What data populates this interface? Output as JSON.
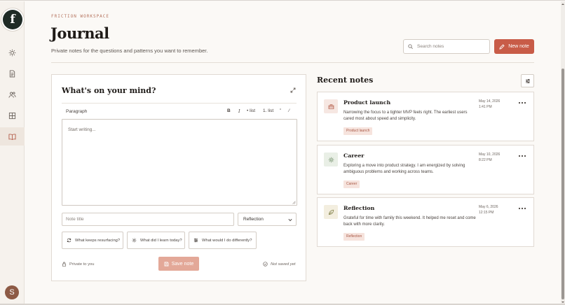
{
  "sidebar": {
    "logo_letter": "f",
    "nav": [
      {
        "name": "dashboard",
        "icon": "sun-icon"
      },
      {
        "name": "documents",
        "icon": "document-icon"
      },
      {
        "name": "people",
        "icon": "people-icon"
      },
      {
        "name": "grid",
        "icon": "grid-icon"
      },
      {
        "name": "journal",
        "icon": "book-icon",
        "active": true
      }
    ],
    "avatar_letter": "S"
  },
  "header": {
    "eyebrow": "FRICTION WORKSPACE",
    "title": "Journal",
    "subtitle": "Private notes for the questions and patterns you want to remember.",
    "search_placeholder": "Search notes",
    "new_note_label": "New note"
  },
  "composer": {
    "title": "What's on your mind?",
    "format_label": "Paragraph",
    "toolbar": {
      "bold": "B",
      "italic": "I",
      "bullet": "• list",
      "numbered": "1. list",
      "quote": "”",
      "link": "⁄"
    },
    "editor_placeholder": "Start writing...",
    "note_title_placeholder": "Note title",
    "category_value": "Reflection",
    "prompts": [
      {
        "label": "What keeps resurfacing?",
        "icon": "refresh-icon"
      },
      {
        "label": "What did I learn today?",
        "icon": "sun-icon"
      },
      {
        "label": "What would I do differently?",
        "icon": "sliders-icon"
      }
    ],
    "privacy_label": "Private to you",
    "save_label": "Save note",
    "save_status": "Not saved yet"
  },
  "recent": {
    "title": "Recent notes",
    "notes": [
      {
        "title": "Product launch",
        "body": "Narrowing the focus to a tighter MVP feels right. The earliest users cared most about speed and simplicity.",
        "tag": "Product launch",
        "date": "May 14, 2026",
        "time": "1:41 PM",
        "icon": "briefcase-icon",
        "icon_bg": "#f6e7e2",
        "icon_color": "#b5604d",
        "tag_bg": "#f6e3dd",
        "tag_color": "#a85744"
      },
      {
        "title": "Career",
        "body": "Exploring a move into product strategy. I am energized by solving ambiguous problems and working across teams.",
        "tag": "Career",
        "date": "May 10, 2026",
        "time": "8:22 PM",
        "icon": "sun-icon",
        "icon_bg": "#e9efe6",
        "icon_color": "#6c8a64",
        "tag_bg": "#f6e3dd",
        "tag_color": "#a85744"
      },
      {
        "title": "Reflection",
        "body": "Grateful for time with family this weekend. It helped me reset and come back with more clarity.",
        "tag": "Reflection",
        "date": "May 6, 2026",
        "time": "12:15 PM",
        "icon": "leaf-icon",
        "icon_bg": "#f3eedf",
        "icon_color": "#8b8a55",
        "tag_bg": "#f6e3dd",
        "tag_color": "#a85744"
      }
    ]
  },
  "colors": {
    "accent": "#c85c48",
    "accent_muted": "#e3a898",
    "sidebar_bg": "#f6f2ed",
    "page_bg": "#fbf9f6"
  }
}
